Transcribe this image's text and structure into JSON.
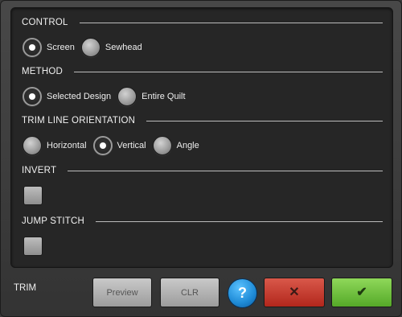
{
  "sections": {
    "control": {
      "title": "CONTROL",
      "options": [
        {
          "label": "Screen",
          "selected": true
        },
        {
          "label": "Sewhead",
          "selected": false
        }
      ]
    },
    "method": {
      "title": "METHOD",
      "options": [
        {
          "label": "Selected Design",
          "selected": true
        },
        {
          "label": "Entire Quilt",
          "selected": false
        }
      ]
    },
    "orientation": {
      "title": "TRIM LINE ORIENTATION",
      "options": [
        {
          "label": "Horizontal",
          "selected": false
        },
        {
          "label": "Vertical",
          "selected": true
        },
        {
          "label": "Angle",
          "selected": false
        }
      ]
    },
    "invert": {
      "title": "INVERT",
      "checked": false
    },
    "jump_stitch": {
      "title": "JUMP STITCH",
      "checked": false
    }
  },
  "footer": {
    "title": "TRIM",
    "preview_label": "Preview",
    "clr_label": "CLR",
    "help_label": "?",
    "cancel_icon": "x-icon",
    "confirm_icon": "check-icon"
  },
  "colors": {
    "cancel": "#c0392b",
    "confirm": "#6cc03a",
    "help": "#1e8ad6"
  }
}
